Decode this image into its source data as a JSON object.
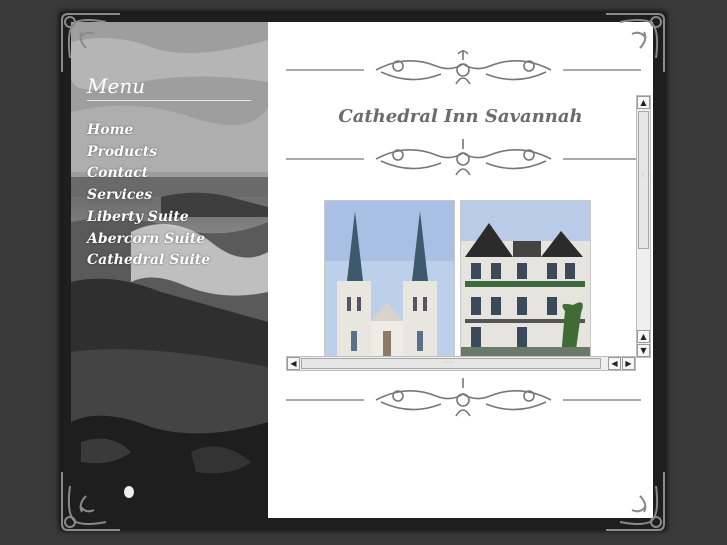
{
  "sidebar": {
    "menu_title": "Menu",
    "items": [
      {
        "label": "Home"
      },
      {
        "label": "Products"
      },
      {
        "label": "Contact"
      },
      {
        "label": "Services"
      },
      {
        "label": "Liberty Suite"
      },
      {
        "label": "Abercorn Suite"
      },
      {
        "label": "Cathedral Suite"
      }
    ]
  },
  "main": {
    "title": "Cathedral Inn Savannah"
  },
  "gallery": {
    "photos": [
      {
        "subject": "cathedral-twin-spires"
      },
      {
        "subject": "victorian-house-with-turrets"
      }
    ]
  },
  "scrollbars": {
    "up_arrow": "▲",
    "down_arrow": "▼",
    "left_arrow": "◀",
    "right_arrow": "▶"
  },
  "colors": {
    "page_bg": "#3a3a3a",
    "content_bg": "#ffffff",
    "title_color": "#6b6b6b",
    "menu_text": "#ffffff"
  }
}
